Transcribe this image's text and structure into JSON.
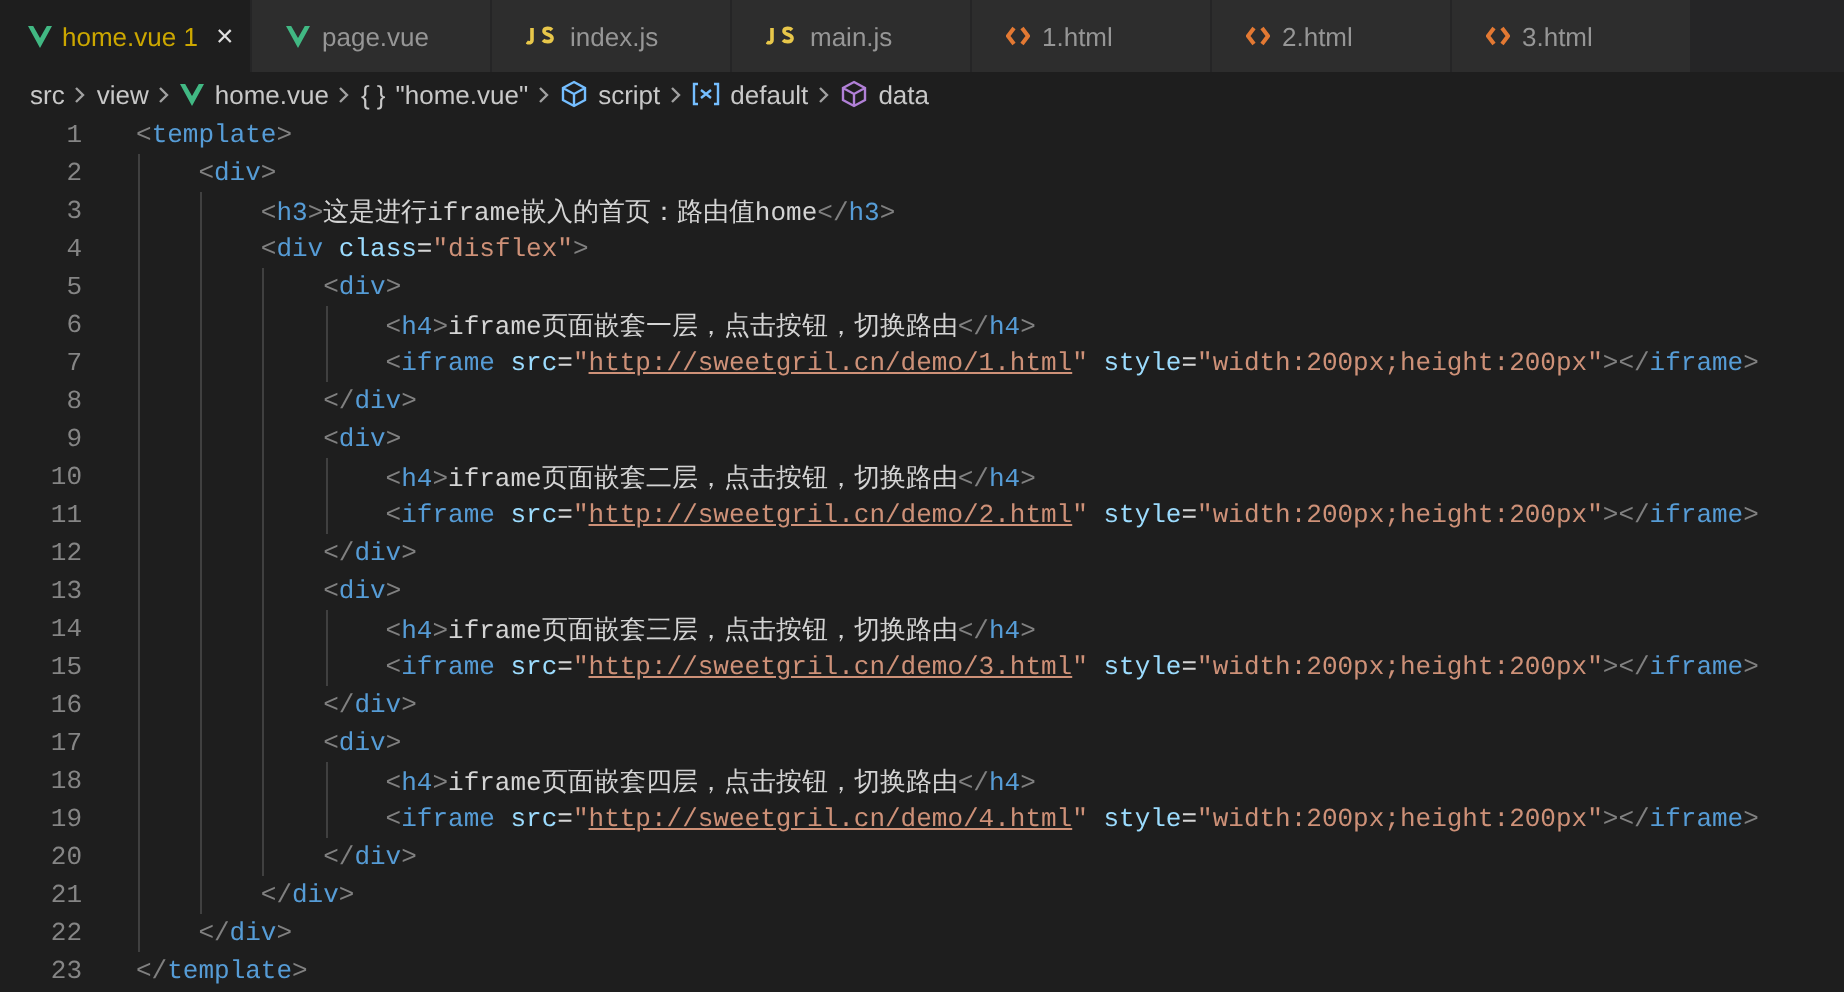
{
  "tabs": [
    {
      "kind": "vue",
      "label": "home.vue",
      "problems": "1",
      "close": "×",
      "selected": true
    },
    {
      "kind": "vue",
      "label": "page.vue",
      "selected": false
    },
    {
      "kind": "js",
      "label": "index.js",
      "selected": false
    },
    {
      "kind": "js",
      "label": "main.js",
      "selected": false
    },
    {
      "kind": "html",
      "label": "1.html",
      "selected": false
    },
    {
      "kind": "html",
      "label": "2.html",
      "selected": false
    },
    {
      "kind": "html",
      "label": "3.html",
      "selected": false
    }
  ],
  "breadcrumb": [
    {
      "kind": "folder",
      "label": "src"
    },
    {
      "kind": "folder",
      "label": "view"
    },
    {
      "kind": "vue",
      "label": "home.vue"
    },
    {
      "kind": "object",
      "glyph": "{ }",
      "label": "\"home.vue\""
    },
    {
      "kind": "module",
      "label": "script"
    },
    {
      "kind": "variable",
      "label": "default"
    },
    {
      "kind": "property",
      "label": "data"
    }
  ],
  "lines": [
    {
      "number": "1",
      "tokens": [
        {
          "kind": "punct",
          "text": "<"
        },
        {
          "kind": "tag",
          "text": "template"
        },
        {
          "kind": "punct",
          "text": ">"
        }
      ],
      "children": [
        {
          "number": "2",
          "tokens": [
            {
              "kind": "punct",
              "text": "<"
            },
            {
              "kind": "tag",
              "text": "div"
            },
            {
              "kind": "punct",
              "text": ">"
            }
          ],
          "children": [
            {
              "number": "3",
              "tokens": [
                {
                  "kind": "punct",
                  "text": "<"
                },
                {
                  "kind": "tag",
                  "text": "h3"
                },
                {
                  "kind": "punct",
                  "text": ">"
                },
                {
                  "kind": "text",
                  "text": "这是进行iframe嵌入的首页：路由值home"
                },
                {
                  "kind": "punct",
                  "text": "</"
                },
                {
                  "kind": "tag",
                  "text": "h3"
                },
                {
                  "kind": "punct",
                  "text": ">"
                }
              ]
            },
            {
              "number": "4",
              "tokens": [
                {
                  "kind": "punct",
                  "text": "<"
                },
                {
                  "kind": "tag",
                  "text": "div"
                },
                {
                  "kind": "attr",
                  "text": " class"
                },
                {
                  "kind": "text",
                  "text": "="
                },
                {
                  "kind": "string",
                  "text": "\"disflex\""
                },
                {
                  "kind": "punct",
                  "text": ">"
                }
              ],
              "children": [
                {
                  "number": "5",
                  "tokens": [
                    {
                      "kind": "punct",
                      "text": "<"
                    },
                    {
                      "kind": "tag",
                      "text": "div"
                    },
                    {
                      "kind": "punct",
                      "text": ">"
                    }
                  ],
                  "children": [
                    {
                      "number": "6",
                      "tokens": [
                        {
                          "kind": "punct",
                          "text": "<"
                        },
                        {
                          "kind": "tag",
                          "text": "h4"
                        },
                        {
                          "kind": "punct",
                          "text": ">"
                        },
                        {
                          "kind": "text",
                          "text": "iframe页面嵌套一层，点击按钮，切换路由"
                        },
                        {
                          "kind": "punct",
                          "text": "</"
                        },
                        {
                          "kind": "tag",
                          "text": "h4"
                        },
                        {
                          "kind": "punct",
                          "text": ">"
                        }
                      ]
                    },
                    {
                      "number": "7",
                      "tokens": [
                        {
                          "kind": "punct",
                          "text": "<"
                        },
                        {
                          "kind": "tag",
                          "text": "iframe"
                        },
                        {
                          "kind": "attr",
                          "text": " src"
                        },
                        {
                          "kind": "text",
                          "text": "="
                        },
                        {
                          "kind": "string",
                          "text": "\""
                        },
                        {
                          "kind": "link",
                          "text": "http://sweetgril.cn/demo/1.html"
                        },
                        {
                          "kind": "string",
                          "text": "\""
                        },
                        {
                          "kind": "attr",
                          "text": " style"
                        },
                        {
                          "kind": "text",
                          "text": "="
                        },
                        {
                          "kind": "string",
                          "text": "\"width:200px;height:200px\""
                        },
                        {
                          "kind": "punct",
                          "text": "></"
                        },
                        {
                          "kind": "tag",
                          "text": "iframe"
                        },
                        {
                          "kind": "punct",
                          "text": ">"
                        }
                      ]
                    }
                  ]
                },
                {
                  "number": "8",
                  "tokens": [
                    {
                      "kind": "punct",
                      "text": "</"
                    },
                    {
                      "kind": "tag",
                      "text": "div"
                    },
                    {
                      "kind": "punct",
                      "text": ">"
                    }
                  ]
                },
                {
                  "number": "9",
                  "tokens": [
                    {
                      "kind": "punct",
                      "text": "<"
                    },
                    {
                      "kind": "tag",
                      "text": "div"
                    },
                    {
                      "kind": "punct",
                      "text": ">"
                    }
                  ],
                  "children": [
                    {
                      "number": "10",
                      "tokens": [
                        {
                          "kind": "punct",
                          "text": "<"
                        },
                        {
                          "kind": "tag",
                          "text": "h4"
                        },
                        {
                          "kind": "punct",
                          "text": ">"
                        },
                        {
                          "kind": "text",
                          "text": "iframe页面嵌套二层，点击按钮，切换路由"
                        },
                        {
                          "kind": "punct",
                          "text": "</"
                        },
                        {
                          "kind": "tag",
                          "text": "h4"
                        },
                        {
                          "kind": "punct",
                          "text": ">"
                        }
                      ]
                    },
                    {
                      "number": "11",
                      "tokens": [
                        {
                          "kind": "punct",
                          "text": "<"
                        },
                        {
                          "kind": "tag",
                          "text": "iframe"
                        },
                        {
                          "kind": "attr",
                          "text": " src"
                        },
                        {
                          "kind": "text",
                          "text": "="
                        },
                        {
                          "kind": "string",
                          "text": "\""
                        },
                        {
                          "kind": "link",
                          "text": "http://sweetgril.cn/demo/2.html"
                        },
                        {
                          "kind": "string",
                          "text": "\""
                        },
                        {
                          "kind": "attr",
                          "text": " style"
                        },
                        {
                          "kind": "text",
                          "text": "="
                        },
                        {
                          "kind": "string",
                          "text": "\"width:200px;height:200px\""
                        },
                        {
                          "kind": "punct",
                          "text": "></"
                        },
                        {
                          "kind": "tag",
                          "text": "iframe"
                        },
                        {
                          "kind": "punct",
                          "text": ">"
                        }
                      ]
                    }
                  ]
                },
                {
                  "number": "12",
                  "tokens": [
                    {
                      "kind": "punct",
                      "text": "</"
                    },
                    {
                      "kind": "tag",
                      "text": "div"
                    },
                    {
                      "kind": "punct",
                      "text": ">"
                    }
                  ]
                },
                {
                  "number": "13",
                  "tokens": [
                    {
                      "kind": "punct",
                      "text": "<"
                    },
                    {
                      "kind": "tag",
                      "text": "div"
                    },
                    {
                      "kind": "punct",
                      "text": ">"
                    }
                  ],
                  "children": [
                    {
                      "number": "14",
                      "tokens": [
                        {
                          "kind": "punct",
                          "text": "<"
                        },
                        {
                          "kind": "tag",
                          "text": "h4"
                        },
                        {
                          "kind": "punct",
                          "text": ">"
                        },
                        {
                          "kind": "text",
                          "text": "iframe页面嵌套三层，点击按钮，切换路由"
                        },
                        {
                          "kind": "punct",
                          "text": "</"
                        },
                        {
                          "kind": "tag",
                          "text": "h4"
                        },
                        {
                          "kind": "punct",
                          "text": ">"
                        }
                      ]
                    },
                    {
                      "number": "15",
                      "tokens": [
                        {
                          "kind": "punct",
                          "text": "<"
                        },
                        {
                          "kind": "tag",
                          "text": "iframe"
                        },
                        {
                          "kind": "attr",
                          "text": " src"
                        },
                        {
                          "kind": "text",
                          "text": "="
                        },
                        {
                          "kind": "string",
                          "text": "\""
                        },
                        {
                          "kind": "link",
                          "text": "http://sweetgril.cn/demo/3.html"
                        },
                        {
                          "kind": "string",
                          "text": "\""
                        },
                        {
                          "kind": "attr",
                          "text": " style"
                        },
                        {
                          "kind": "text",
                          "text": "="
                        },
                        {
                          "kind": "string",
                          "text": "\"width:200px;height:200px\""
                        },
                        {
                          "kind": "punct",
                          "text": "></"
                        },
                        {
                          "kind": "tag",
                          "text": "iframe"
                        },
                        {
                          "kind": "punct",
                          "text": ">"
                        }
                      ]
                    }
                  ]
                },
                {
                  "number": "16",
                  "tokens": [
                    {
                      "kind": "punct",
                      "text": "</"
                    },
                    {
                      "kind": "tag",
                      "text": "div"
                    },
                    {
                      "kind": "punct",
                      "text": ">"
                    }
                  ]
                },
                {
                  "number": "17",
                  "tokens": [
                    {
                      "kind": "punct",
                      "text": "<"
                    },
                    {
                      "kind": "tag",
                      "text": "div"
                    },
                    {
                      "kind": "punct",
                      "text": ">"
                    }
                  ],
                  "children": [
                    {
                      "number": "18",
                      "tokens": [
                        {
                          "kind": "punct",
                          "text": "<"
                        },
                        {
                          "kind": "tag",
                          "text": "h4"
                        },
                        {
                          "kind": "punct",
                          "text": ">"
                        },
                        {
                          "kind": "text",
                          "text": "iframe页面嵌套四层，点击按钮，切换路由"
                        },
                        {
                          "kind": "punct",
                          "text": "</"
                        },
                        {
                          "kind": "tag",
                          "text": "h4"
                        },
                        {
                          "kind": "punct",
                          "text": ">"
                        }
                      ]
                    },
                    {
                      "number": "19",
                      "tokens": [
                        {
                          "kind": "punct",
                          "text": "<"
                        },
                        {
                          "kind": "tag",
                          "text": "iframe"
                        },
                        {
                          "kind": "attr",
                          "text": " src"
                        },
                        {
                          "kind": "text",
                          "text": "="
                        },
                        {
                          "kind": "string",
                          "text": "\""
                        },
                        {
                          "kind": "link",
                          "text": "http://sweetgril.cn/demo/4.html"
                        },
                        {
                          "kind": "string",
                          "text": "\""
                        },
                        {
                          "kind": "attr",
                          "text": " style"
                        },
                        {
                          "kind": "text",
                          "text": "="
                        },
                        {
                          "kind": "string",
                          "text": "\"width:200px;height:200px\""
                        },
                        {
                          "kind": "punct",
                          "text": "></"
                        },
                        {
                          "kind": "tag",
                          "text": "iframe"
                        },
                        {
                          "kind": "punct",
                          "text": ">"
                        }
                      ]
                    }
                  ]
                },
                {
                  "number": "20",
                  "tokens": [
                    {
                      "kind": "punct",
                      "text": "</"
                    },
                    {
                      "kind": "tag",
                      "text": "div"
                    },
                    {
                      "kind": "punct",
                      "text": ">"
                    }
                  ]
                }
              ]
            },
            {
              "number": "21",
              "tokens": [
                {
                  "kind": "punct",
                  "text": "</"
                },
                {
                  "kind": "tag",
                  "text": "div"
                },
                {
                  "kind": "punct",
                  "text": ">"
                }
              ]
            }
          ]
        },
        {
          "number": "22",
          "tokens": [
            {
              "kind": "punct",
              "text": "</"
            },
            {
              "kind": "tag",
              "text": "div"
            },
            {
              "kind": "punct",
              "text": ">"
            }
          ]
        }
      ]
    },
    {
      "number": "23",
      "tokens": [
        {
          "kind": "punct",
          "text": "</"
        },
        {
          "kind": "tag",
          "text": "template"
        },
        {
          "kind": "punct",
          "text": ">"
        }
      ]
    }
  ]
}
